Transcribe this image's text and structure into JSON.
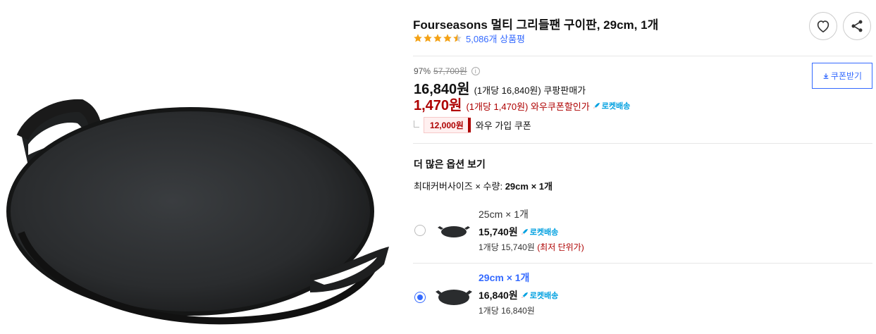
{
  "product": {
    "title": "Fourseasons 멀티 그리들팬 구이판, 29cm, 1개",
    "rating": 4.5,
    "review_count": "5,086개 상품평"
  },
  "icons": {
    "wish": "heart-icon",
    "share": "share-icon",
    "download": "download-icon",
    "rocket": "rocket-icon",
    "info": "info-icon"
  },
  "pricing": {
    "discount_rate": "97%",
    "original_price": "57,700원",
    "sale_price": "16,840원",
    "sale_unit": "(1개당 16,840원) 쿠팡판매가",
    "wow_price": "1,470원",
    "wow_unit": "(1개당 1,470원) 와우쿠폰할인가",
    "rocket_label": "로켓배송",
    "coupon_amount": "12,000원",
    "coupon_label": "와우 가입 쿠폰",
    "download_coupon_label": "쿠폰받기"
  },
  "options": {
    "heading": "더 많은 옵션 보기",
    "summary_label": "최대커버사이즈 × 수량:",
    "summary_value": "29cm × 1개",
    "items": [
      {
        "name": "25cm × 1개",
        "price": "15,740원",
        "rocket": "로켓배송",
        "unit": "1개당 15,740원",
        "note": "(최저 단위가)",
        "selected": false
      },
      {
        "name": "29cm × 1개",
        "price": "16,840원",
        "rocket": "로켓배송",
        "unit": "1개당 16,840원",
        "note": "",
        "selected": true
      }
    ]
  },
  "colors": {
    "accent_blue": "#346aff",
    "price_red": "#ae0000",
    "star_orange": "#f4a216",
    "rocket_blue": "#00a0e0"
  }
}
